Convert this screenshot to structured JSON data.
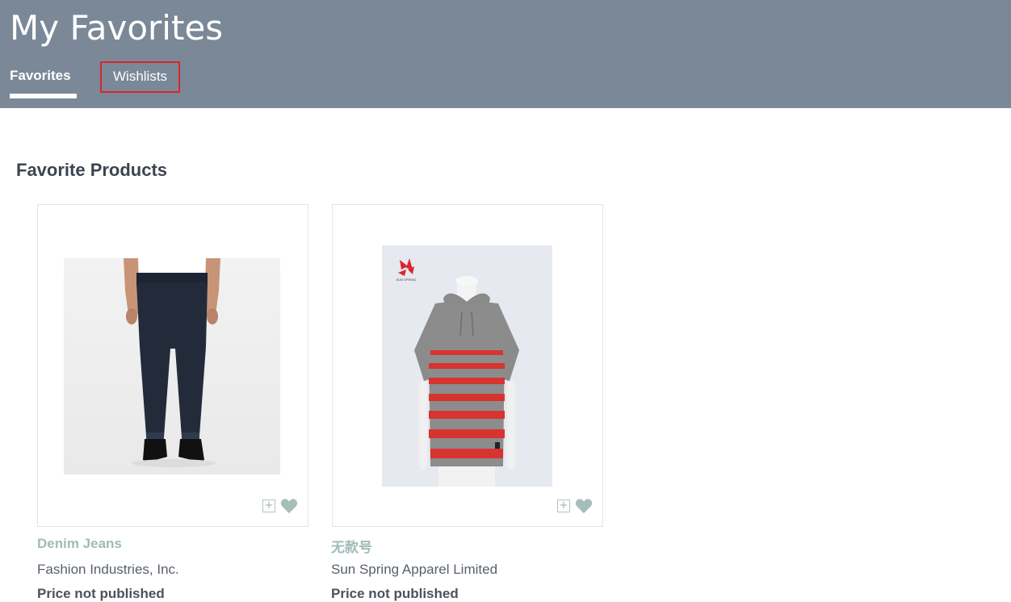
{
  "header": {
    "title": "My Favorites",
    "tabs": [
      {
        "label": "Favorites",
        "active": true
      },
      {
        "label": "Wishlists",
        "active": false
      }
    ],
    "background_color": "#7b8898",
    "highlight_color": "#d9262c"
  },
  "section": {
    "title": "Favorite Products"
  },
  "products": [
    {
      "name": "Denim Jeans",
      "supplier": "Fashion Industries, Inc.",
      "price": "Price not published",
      "image_icon": "product-photo-jeans"
    },
    {
      "name": "无款号",
      "supplier": "Sun Spring Apparel Limited",
      "price": "Price not published",
      "image_icon": "product-photo-hoodie",
      "brand_logo_text": "SUN SPRING"
    }
  ],
  "card_actions": {
    "add_symbol": "+",
    "add_icon": "add-to-list-icon",
    "favorite_icon": "heart-icon",
    "accent_color": "#9fbcb7"
  }
}
